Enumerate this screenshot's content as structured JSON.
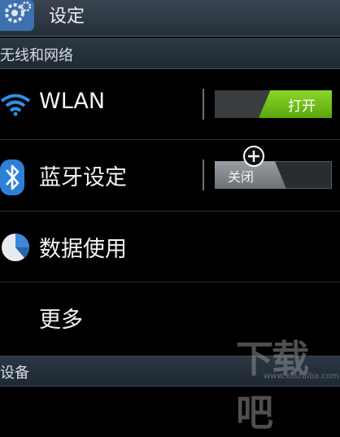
{
  "header": {
    "title": "设定",
    "icon": "gear-icon"
  },
  "sections": {
    "network": "无线和网络",
    "device": "设备"
  },
  "items": [
    {
      "label": "WLAN",
      "icon": "wifi-icon",
      "toggle": {
        "state": "on",
        "text": "打开"
      }
    },
    {
      "label": "蓝牙设定",
      "icon": "bluetooth-icon",
      "toggle": {
        "state": "off",
        "text": "关闭"
      }
    },
    {
      "label": "数据使用",
      "icon": "pie-chart-icon"
    },
    {
      "label": "更多"
    }
  ],
  "watermark": {
    "text": "下载吧",
    "url": "www.xiazaiba.com"
  },
  "colors": {
    "toggle_on": "#7cc520",
    "header_bg": "#2f3945",
    "section_bg": "#26303b"
  }
}
